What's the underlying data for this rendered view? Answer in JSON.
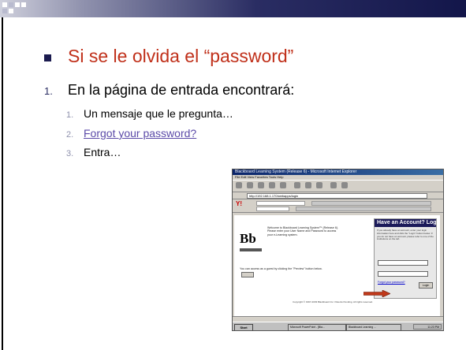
{
  "slide": {
    "title": "Si se le olvida el “password”",
    "step": {
      "number": "1.",
      "text": "En la página de entrada encontrará:"
    },
    "subitems": [
      {
        "number": "1.",
        "text": "Un mensaje que le pregunta…"
      },
      {
        "number": "2.",
        "text": "Forgot your password?"
      },
      {
        "number": "3.",
        "text": "Entra…"
      }
    ]
  },
  "screenshot": {
    "window_title": "Blackboard Learning System (Release 6) - Microsoft Internet Explorer",
    "menu": "File   Edit   View   Favorites   Tools   Help",
    "address": "http://192.168.1.170/webapps/login",
    "logo": "Bb",
    "welcome_text": "Welcome to Blackboard Learning System™ (Release 6). Please enter your User Name and Password to access your e-Learning system.",
    "guest_text": "You can access as a guest by clicking the \"Preview\" button below.",
    "preview_button": "Preview",
    "panel_title": "Have an Account? Login Here.",
    "panel_text": "If you already have an account, enter your login information here and click the \"Login\" button below. If you do not have an account, please refer to one of the institutions on the left.",
    "username_label": "Username:",
    "password_label": "Password:",
    "forgot_link": "Forgot your password?",
    "login_button": "Login",
    "copyright": "Copyright © 1997-2003 Blackboard Inc. Patents Pending. All rights reserved.",
    "start_button": "Start",
    "taskbar_items": [
      "Microsoft PowerPoint - [Bla...",
      "Blackboard Learning ..."
    ],
    "clock": "11:23 PM"
  },
  "colors": {
    "title": "#c0301a",
    "accent": "#2a2d63",
    "link": "#5b4aa8",
    "arrow": "#c0391b"
  }
}
